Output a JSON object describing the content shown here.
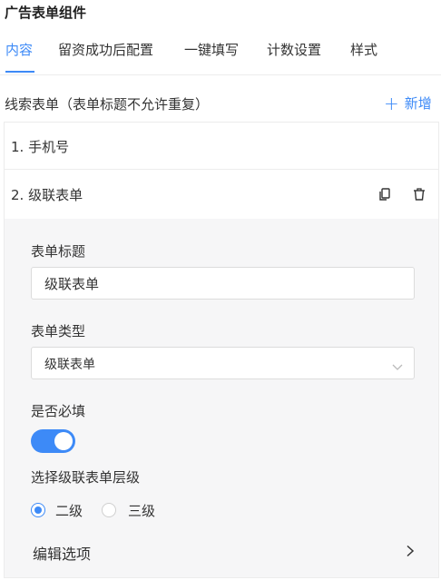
{
  "header": {
    "title": "广告表单组件"
  },
  "tabs": [
    {
      "label": "内容",
      "active": true
    },
    {
      "label": "留资成功后配置",
      "active": false
    },
    {
      "label": "一键填写",
      "active": false
    },
    {
      "label": "计数设置",
      "active": false
    },
    {
      "label": "样式",
      "active": false
    }
  ],
  "section": {
    "label": "线索表单（表单标题不允许重复）",
    "add_label": "新增"
  },
  "form_list": [
    {
      "label": "1.  手机号"
    },
    {
      "label": "2.  级联表单"
    }
  ],
  "item_icons": {
    "copy": "copy-icon",
    "delete": "trash-icon"
  },
  "editor": {
    "title_label": "表单标题",
    "title_value": "级联表单",
    "type_label": "表单类型",
    "type_value": "级联表单",
    "required_label": "是否必填",
    "required_on": true,
    "level_label": "选择级联表单层级",
    "level_options": [
      {
        "label": "二级",
        "checked": true
      },
      {
        "label": "三级",
        "checked": false
      }
    ],
    "edit_options_label": "编辑选项"
  },
  "colors": {
    "accent": "#3d8af7",
    "panel_bg": "#f6f6f7",
    "border": "#dcdcdc"
  }
}
